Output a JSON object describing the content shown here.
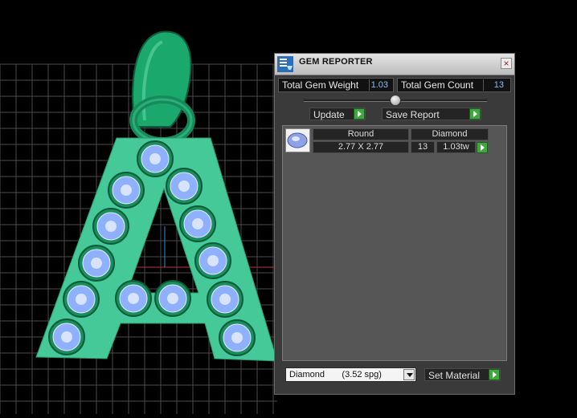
{
  "viewport": {
    "background": "#000000",
    "grid_color": "#4a4a4a",
    "pendant_color": "#3fbf8a",
    "gem_color": "#8fb0ff",
    "bail_color": "#1a8f5e"
  },
  "panel": {
    "title": "GEM REPORTER",
    "close_glyph": "×",
    "stats": {
      "total_gem_weight_label": "Total Gem Weight",
      "total_gem_weight_value": "1.03",
      "total_gem_count_label": "Total Gem Count",
      "total_gem_count_value": "13"
    },
    "buttons": {
      "update_label": "Update",
      "save_report_label": "Save Report",
      "set_material_label": "Set Material"
    },
    "gem_list": {
      "rows": [
        {
          "shape": "Round",
          "material": "Diamond",
          "size": "2.77 X 2.77",
          "count": "13",
          "weight": "1.03tw"
        }
      ]
    },
    "material_select": {
      "selected": "Diamond       (3.52 spg)"
    }
  }
}
